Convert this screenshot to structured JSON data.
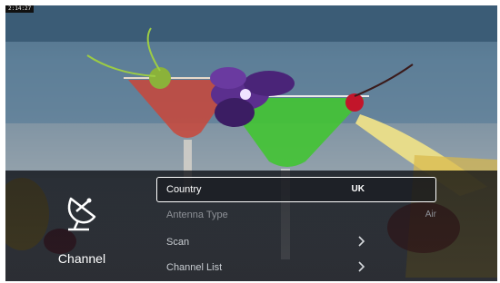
{
  "timestamp": "2:14:27",
  "category": {
    "label": "Channel",
    "icon": "satellite-dish-icon"
  },
  "menu": {
    "items": [
      {
        "label": "Country",
        "value": "UK",
        "focused": true
      },
      {
        "label": "Antenna Type",
        "value": "Air",
        "disabled": true
      },
      {
        "label": "Scan",
        "value": ""
      },
      {
        "label": "Channel List",
        "value": ""
      }
    ]
  }
}
